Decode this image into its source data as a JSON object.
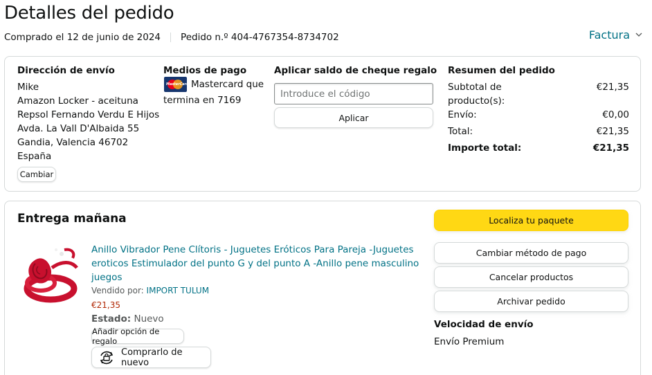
{
  "header": {
    "title": "Detalles del pedido",
    "purchased": "Comprado el 12 de junio de 2024",
    "order_number": "Pedido n.º 404-4767354-8734702",
    "invoice_label": "Factura",
    "invoice_icon": "chevron-down-icon"
  },
  "shipping": {
    "heading": "Dirección de envío",
    "lines": [
      "Mike",
      "Amazon Locker - aceituna",
      "Repsol Fernando Verdu E Hijos",
      "Avda. La Vall D'Albaida 55",
      "Gandia, Valencia 46702",
      "España"
    ],
    "change_label": "Cambiar"
  },
  "payment": {
    "heading": "Medios de pago",
    "card_line1": "Mastercard que",
    "card_line2": "termina en 7169",
    "card_icon": "mastercard-icon"
  },
  "gift": {
    "heading": "Aplicar saldo de cheque regalo",
    "placeholder": "Introduce el código",
    "apply_label": "Aplicar"
  },
  "summary": {
    "heading": "Resumen del pedido",
    "subtotal_label": "Subtotal de producto(s):",
    "subtotal_value": "€21,35",
    "shipping_label": "Envío:",
    "shipping_value": "€0,00",
    "total_label": "Total:",
    "total_value": "€21,35",
    "grand_label": "Importe total:",
    "grand_value": "€21,35"
  },
  "delivery": {
    "heading": "Entrega mañana",
    "product": {
      "title": "Anillo Vibrador Pene Clítoris - Juguetes Eróticos Para Pareja -Juguetes eroticos Estimulador del punto G y del punto A -Anillo pene masculino juegos",
      "sold_by_label": "Vendido por:",
      "seller": "IMPORT TULUM",
      "price": "€21,35",
      "state_label": "Estado:",
      "state_value": "Nuevo",
      "gift_option_label": "Añadir opción de regalo",
      "buy_again_label": "Comprarlo de nuevo",
      "buy_again_icon": "buy-again-icon"
    },
    "actions": {
      "track": "Localiza tu paquete",
      "change_payment": "Cambiar método de pago",
      "cancel": "Cancelar productos",
      "archive": "Archivar pedido"
    },
    "speed_heading": "Velocidad de envío",
    "speed_value": "Envío Premium"
  },
  "colors": {
    "link": "#007185",
    "primary_button": "#FFD814",
    "price": "#B12704",
    "border": "#D5D9D9"
  }
}
